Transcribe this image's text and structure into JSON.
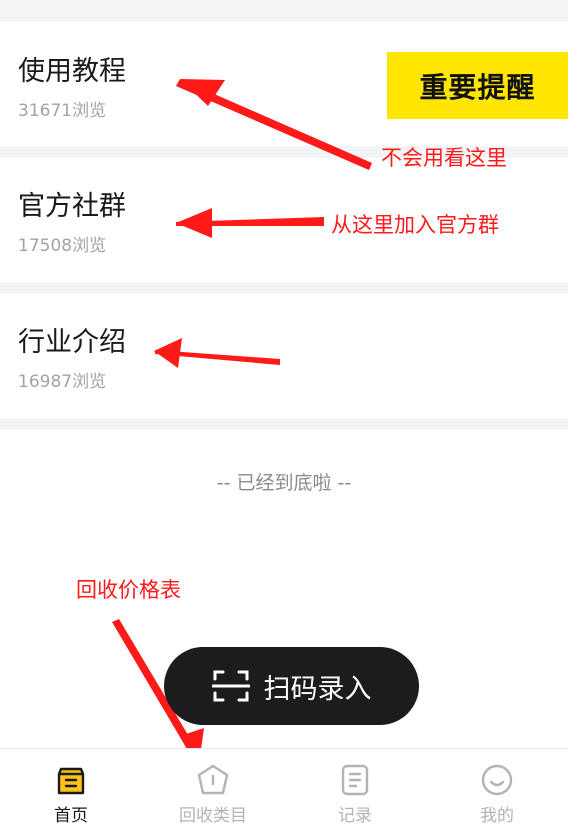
{
  "articles": [
    {
      "title": "使用教程",
      "views": "31671浏览"
    },
    {
      "title": "官方社群",
      "views": "17508浏览"
    },
    {
      "title": "行业介绍",
      "views": "16987浏览"
    }
  ],
  "reminder_badge": "重要提醒",
  "end_text": "-- 已经到底啦 --",
  "annotations": {
    "tutorial": "不会用看这里",
    "group": "从这里加入官方群",
    "price_list": "回收价格表"
  },
  "scan_button": {
    "label": "扫码录入",
    "icon": "scan-frame-icon"
  },
  "tabbar": [
    {
      "label": "首页",
      "icon": "home-bag-icon",
      "active": true
    },
    {
      "label": "回收类目",
      "icon": "category-pentagon-icon",
      "active": false
    },
    {
      "label": "记录",
      "icon": "record-document-icon",
      "active": false
    },
    {
      "label": "我的",
      "icon": "profile-smile-icon",
      "active": false
    }
  ],
  "colors": {
    "accent": "#ffe600",
    "annotation": "#ff1a1a",
    "dark": "#1c1c1c"
  }
}
